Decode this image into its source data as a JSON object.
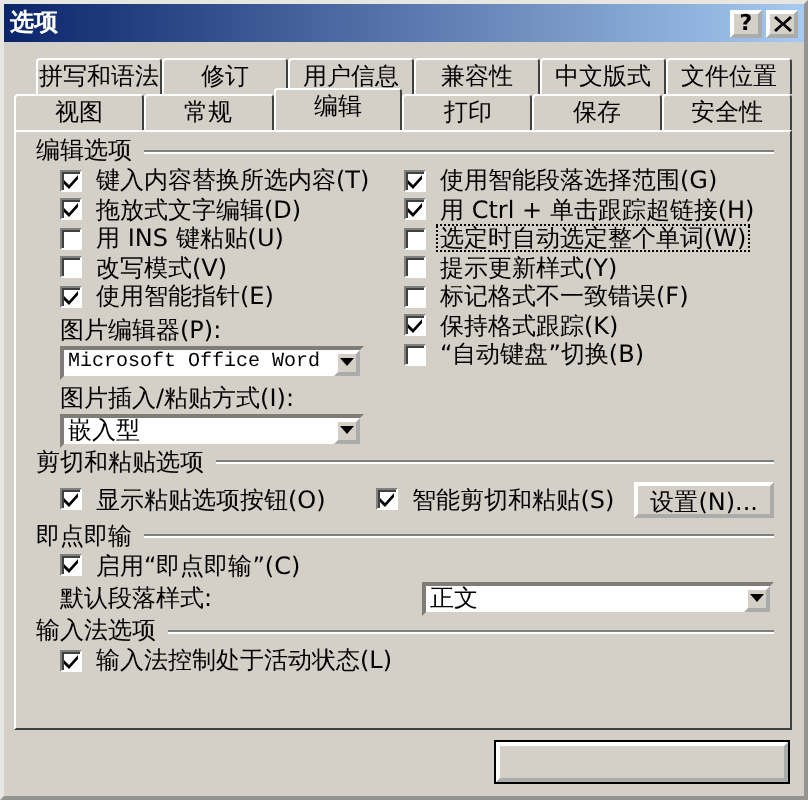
{
  "window": {
    "title": "选项",
    "help_button": "?"
  },
  "tabs": {
    "back_row": [
      {
        "label": "拼写和语法",
        "selected": false
      },
      {
        "label": "修订",
        "selected": false
      },
      {
        "label": "用户信息",
        "selected": false
      },
      {
        "label": "兼容性",
        "selected": false
      },
      {
        "label": "中文版式",
        "selected": false
      },
      {
        "label": "文件位置",
        "selected": false
      }
    ],
    "front_row": [
      {
        "label": "视图",
        "selected": false
      },
      {
        "label": "常规",
        "selected": false
      },
      {
        "label": "编辑",
        "selected": true
      },
      {
        "label": "打印",
        "selected": false
      },
      {
        "label": "保存",
        "selected": false
      },
      {
        "label": "安全性",
        "selected": false
      }
    ]
  },
  "editing": {
    "title": "编辑选项",
    "left_options": [
      {
        "label": "键入内容替换所选内容(T)",
        "checked": true,
        "focused": false
      },
      {
        "label": "拖放式文字编辑(D)",
        "checked": true,
        "focused": false
      },
      {
        "label": "用 INS 键粘贴(U)",
        "checked": false,
        "focused": false
      },
      {
        "label": "改写模式(V)",
        "checked": false,
        "focused": false
      },
      {
        "label": "使用智能指针(E)",
        "checked": true,
        "focused": false
      }
    ],
    "picture_editor": {
      "label": "图片编辑器(P):",
      "value": "Microsoft Office Word"
    },
    "picture_insert": {
      "label": "图片插入/粘贴方式(I):",
      "value": "嵌入型"
    },
    "right_options": [
      {
        "label": "使用智能段落选择范围(G)",
        "checked": true,
        "focused": false
      },
      {
        "label": "用 Ctrl + 单击跟踪超链接(H)",
        "checked": true,
        "focused": false
      },
      {
        "label": "选定时自动选定整个单词(W)",
        "checked": false,
        "focused": true
      },
      {
        "label": "提示更新样式(Y)",
        "checked": false,
        "focused": false
      },
      {
        "label": "标记格式不一致错误(F)",
        "checked": false,
        "focused": false
      },
      {
        "label": "保持格式跟踪(K)",
        "checked": true,
        "focused": false
      },
      {
        "label": "“自动键盘”切换(B)",
        "checked": false,
        "focused": false
      }
    ]
  },
  "cut_paste": {
    "title": "剪切和粘贴选项",
    "options": [
      {
        "label": "显示粘贴选项按钮(O)",
        "checked": true,
        "focused": false
      },
      {
        "label": "智能剪切和粘贴(S)",
        "checked": true,
        "focused": false
      }
    ],
    "settings_button": "设置(N)..."
  },
  "click_and_type": {
    "title": "即点即输",
    "option": {
      "label": "启用“即点即输”(C)",
      "checked": true,
      "focused": false
    },
    "style_label": "默认段落样式:",
    "style_value": "正文"
  },
  "ime": {
    "title": "输入法选项",
    "option": {
      "label": "输入法控制处于活动状态(L)",
      "checked": true,
      "focused": false
    }
  }
}
